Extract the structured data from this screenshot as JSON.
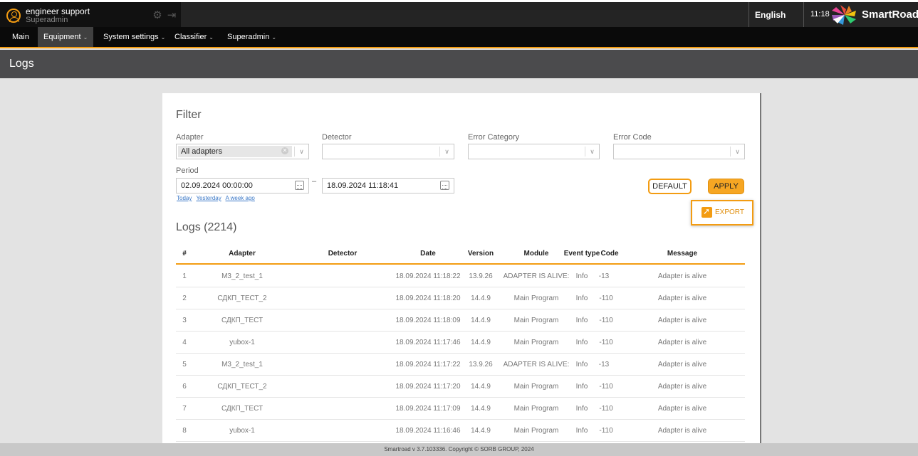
{
  "header": {
    "user_name": "engineer support",
    "user_role": "Superadmin",
    "language": "English",
    "time": "11:18",
    "brand": "SmartRoad"
  },
  "nav": {
    "items": [
      {
        "label": "Main"
      },
      {
        "label": "Equipment",
        "chevron": "⌄"
      },
      {
        "label": "System settings",
        "chevron": "⌄"
      },
      {
        "label": "Classifier",
        "chevron": "⌄"
      },
      {
        "label": "Superadmin",
        "chevron": "⌄"
      }
    ]
  },
  "page": {
    "title": "Logs"
  },
  "filter": {
    "heading": "Filter",
    "adapter_label": "Adapter",
    "adapter_value": "All adapters",
    "detector_label": "Detector",
    "error_category_label": "Error Category",
    "error_code_label": "Error Code",
    "period_label": "Period",
    "date_from": "02.09.2024 00:00:00",
    "date_to": "18.09.2024 11:18:41",
    "dash": "–",
    "quick_today": "Today",
    "quick_yesterday": "Yesterday",
    "quick_week": "A week ago",
    "default_label": "DEFAULT",
    "apply_label": "APPLY",
    "export_label": "EXPORT"
  },
  "logs": {
    "heading": "Logs (2214)",
    "columns": [
      "#",
      "Adapter",
      "Detector",
      "Date",
      "Version",
      "Module",
      "Event type",
      "Code",
      "Message"
    ],
    "rows": [
      [
        "1",
        "M3_2_test_1",
        "",
        "18.09.2024 11:18:22",
        "13.9.26",
        "ADAPTER IS ALIVE:",
        "Info",
        "-13",
        "Adapter is alive"
      ],
      [
        "2",
        "СДКП_ТЕСТ_2",
        "",
        "18.09.2024 11:18:20",
        "14.4.9",
        "Main Program",
        "Info",
        "-110",
        "Adapter is alive"
      ],
      [
        "3",
        "СДКП_ТЕСТ",
        "",
        "18.09.2024 11:18:09",
        "14.4.9",
        "Main Program",
        "Info",
        "-110",
        "Adapter is alive"
      ],
      [
        "4",
        "yubox-1",
        "",
        "18.09.2024 11:17:46",
        "14.4.9",
        "Main Program",
        "Info",
        "-110",
        "Adapter is alive"
      ],
      [
        "5",
        "M3_2_test_1",
        "",
        "18.09.2024 11:17:22",
        "13.9.26",
        "ADAPTER IS ALIVE:",
        "Info",
        "-13",
        "Adapter is alive"
      ],
      [
        "6",
        "СДКП_ТЕСТ_2",
        "",
        "18.09.2024 11:17:20",
        "14.4.9",
        "Main Program",
        "Info",
        "-110",
        "Adapter is alive"
      ],
      [
        "7",
        "СДКП_ТЕСТ",
        "",
        "18.09.2024 11:17:09",
        "14.4.9",
        "Main Program",
        "Info",
        "-110",
        "Adapter is alive"
      ],
      [
        "8",
        "yubox-1",
        "",
        "18.09.2024 11:16:46",
        "14.4.9",
        "Main Program",
        "Info",
        "-110",
        "Adapter is alive"
      ]
    ]
  },
  "footer": {
    "text": "Smartroad v 3.7.103336. Copyright © SORB GROUP, 2024"
  },
  "colors": {
    "accent": "#f39c12",
    "topbar": "#242424",
    "pagebar": "#4b4b4d"
  }
}
